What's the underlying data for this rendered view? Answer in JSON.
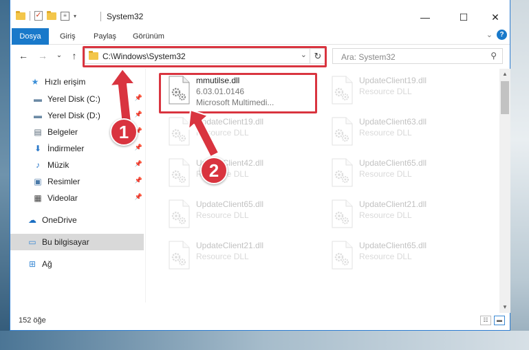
{
  "window": {
    "title": "System32",
    "minimize_glyph": "—",
    "maximize_glyph": "☐",
    "close_glyph": "✕",
    "quick_access_props_glyph": "≡",
    "quick_access_caret_glyph": "▾",
    "quick_access_check_glyph": "✓"
  },
  "ribbon": {
    "tabs": [
      "Dosya",
      "Giriş",
      "Paylaş",
      "Görünüm"
    ],
    "expand_glyph": "⌄",
    "help_glyph": "?"
  },
  "nav": {
    "back_glyph": "←",
    "forward_glyph": "→",
    "recent_glyph": "⌄",
    "up_glyph": "↑",
    "address": "C:\\Windows\\System32",
    "address_caret": "⌄",
    "refresh_glyph": "↻",
    "search_placeholder": "Ara: System32",
    "search_glyph": "⚲"
  },
  "sidebar": {
    "pin_glyph": "📌",
    "items": [
      {
        "label": "Hızlı erişim",
        "icon": "star-icon",
        "glyph": "★",
        "color": "#3b8fd8",
        "pinned": false
      },
      {
        "label": "Yerel Disk (C:)",
        "icon": "drive-icon",
        "glyph": "▬",
        "color": "#6c8aa5",
        "pinned": true
      },
      {
        "label": "Yerel Disk (D:)",
        "icon": "drive-icon",
        "glyph": "▬",
        "color": "#6c8aa5",
        "pinned": true
      },
      {
        "label": "Belgeler",
        "icon": "document-icon",
        "glyph": "▤",
        "color": "#5a6b7a",
        "pinned": true
      },
      {
        "label": "İndirmeler",
        "icon": "download-icon",
        "glyph": "⬇",
        "color": "#2a78c9",
        "pinned": true
      },
      {
        "label": "Müzik",
        "icon": "music-icon",
        "glyph": "♪",
        "color": "#2a78c9",
        "pinned": true
      },
      {
        "label": "Resimler",
        "icon": "pictures-icon",
        "glyph": "▣",
        "color": "#4b7aa8",
        "pinned": true
      },
      {
        "label": "Videolar",
        "icon": "video-icon",
        "glyph": "▦",
        "color": "#444",
        "pinned": true
      },
      {
        "label": "OneDrive",
        "icon": "cloud-icon",
        "glyph": "☁",
        "color": "#1a6ec2",
        "pinned": false
      },
      {
        "label": "Bu bilgisayar",
        "icon": "computer-icon",
        "glyph": "▭",
        "color": "#3a89d4",
        "pinned": false,
        "selected": true
      },
      {
        "label": "Ağ",
        "icon": "network-icon",
        "glyph": "⊞",
        "color": "#3a89d4",
        "pinned": false
      }
    ]
  },
  "files": {
    "left": [
      {
        "name": "mmutilse.dll",
        "line2": "6.03.01.0146",
        "line3": "Microsoft Multimedi...",
        "highlighted": true
      },
      {
        "name": "UpdateClient19.dll",
        "line2": "Resource DLL"
      },
      {
        "name": "UpdateClient42.dll",
        "line2": "Resource DLL"
      },
      {
        "name": "UpdateClient65.dll",
        "line2": "Resource DLL"
      },
      {
        "name": "UpdateClient21.dll",
        "line2": "Resource DLL"
      }
    ],
    "right": [
      {
        "name": "UpdateClient19.dll",
        "line2": "Resource DLL"
      },
      {
        "name": "UpdateClient63.dll",
        "line2": "Resource DLL"
      },
      {
        "name": "UpdateClient65.dll",
        "line2": "Resource DLL"
      },
      {
        "name": "UpdateClient21.dll",
        "line2": "Resource DLL"
      },
      {
        "name": "UpdateClient65.dll",
        "line2": "Resource DLL"
      }
    ]
  },
  "scrollbar": {
    "up_glyph": "▲",
    "down_glyph": "▼"
  },
  "status": {
    "item_count": "152 öğe",
    "details_view_glyph": "☷",
    "tiles_view_glyph": "▬"
  },
  "annotations": {
    "step1": "1",
    "step2": "2",
    "color": "#d9343f"
  }
}
